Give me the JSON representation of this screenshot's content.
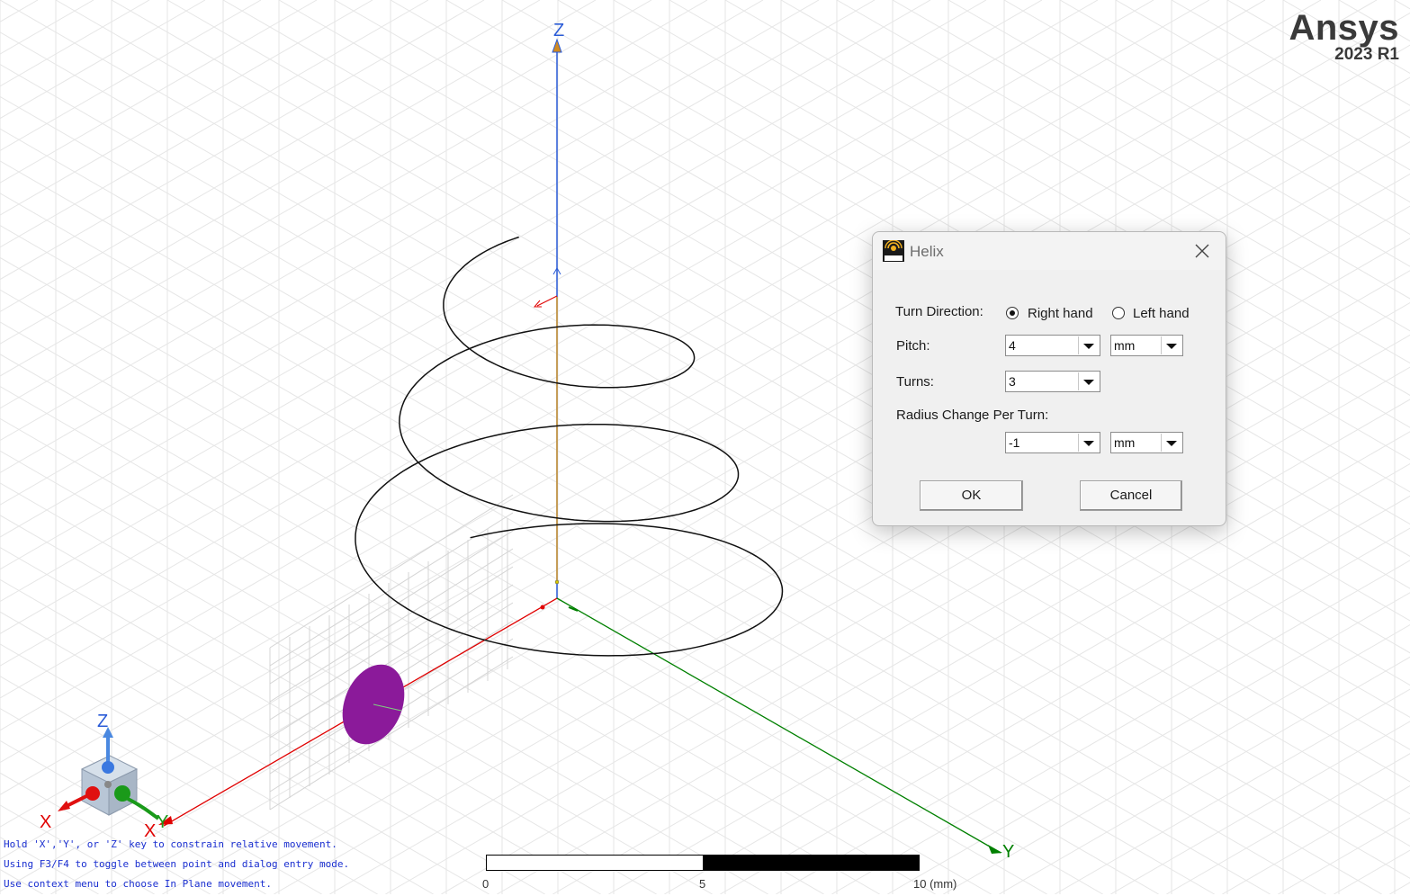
{
  "brand": {
    "name": "Ansys",
    "version": "2023 R1"
  },
  "axes": {
    "z_label": "Z",
    "x_label": "X",
    "y_label": "Y"
  },
  "triad": {
    "z_label": "Z",
    "x_label": "X",
    "y_label": "Y"
  },
  "colors": {
    "x_axis": "#e00000",
    "y_axis": "#008000",
    "z_axis": "#2a5bd7",
    "helix": "#111111",
    "ellipse": "#8b1a9a",
    "grid": "#d8d8d8"
  },
  "hints": [
    "Hold 'X','Y', or 'Z' key to constrain relative movement.",
    "Using F3/F4 to toggle between point and dialog entry mode.",
    "Use context menu to choose In Plane movement."
  ],
  "scale": {
    "labels": [
      "0",
      "5",
      "10 (mm)"
    ]
  },
  "dialog": {
    "title": "Helix",
    "app_icon": "edt-app-icon",
    "close_icon": "close-icon",
    "turn_direction_label": "Turn Direction:",
    "right_hand_label": "Right hand",
    "left_hand_label": "Left hand",
    "turn_direction_selected": "Right hand",
    "pitch_label": "Pitch:",
    "pitch_value": "4",
    "pitch_unit": "mm",
    "turns_label": "Turns:",
    "turns_value": "3",
    "radius_change_label": "Radius Change Per Turn:",
    "radius_change_value": "-1",
    "radius_change_unit": "mm",
    "ok_label": "OK",
    "cancel_label": "Cancel"
  }
}
